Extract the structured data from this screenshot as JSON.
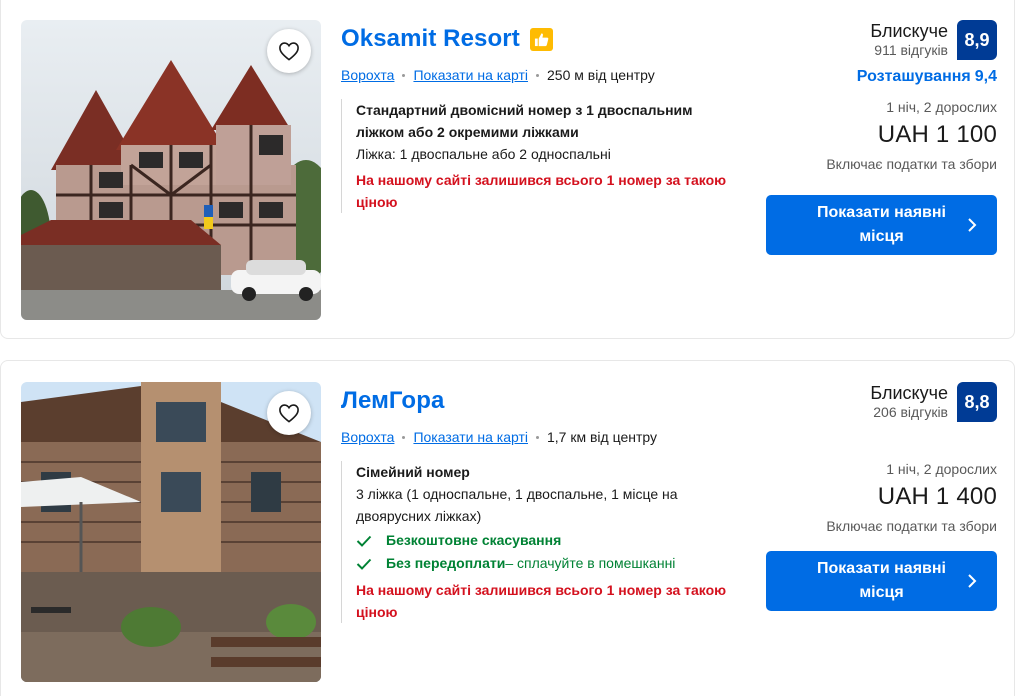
{
  "properties": [
    {
      "name": "Oksamit Resort",
      "has_genius_badge": true,
      "city": "Ворохта",
      "map_link": "Показати на карті",
      "distance": "250 м від центру",
      "room_name": "Стандартний двомісний номер з 1 двоспальним ліжком або 2 окремими ліжками",
      "beds": "Ліжка: 1 двоспальне або 2 односпальні",
      "warning": "На нашому сайті залишився всього 1 номер за такою ціною",
      "rating_word": "Блискуче",
      "review_count": "911 відгуків",
      "score": "8,9",
      "location_label": "Розташування",
      "location_score": "9,4",
      "occupancy": "1 ніч, 2 дорослих",
      "price": "UAH 1 100",
      "taxes": "Включає податки та збори",
      "cta": "Показати наявні місця"
    },
    {
      "name": "ЛемГора",
      "city": "Ворохта",
      "map_link": "Показати на карті",
      "distance": "1,7 км від центру",
      "room_name": "Сімейний номер",
      "beds": "3 ліжка (1 односпальне, 1 двоспальне, 1 місце на двоярусних ліжках)",
      "benefits": [
        {
          "label": "Безкоштовне скасування",
          "rest": ""
        },
        {
          "label": "Без передоплати",
          "rest": " – сплачуйте в помешканні"
        }
      ],
      "warning": "На нашому сайті залишився всього 1 номер за такою ціною",
      "rating_word": "Блискуче",
      "review_count": "206 відгуків",
      "score": "8,8",
      "occupancy": "1 ніч, 2 дорослих",
      "price": "UAH 1 400",
      "taxes": "Включає податки та збори",
      "cta": "Показати наявні місця"
    }
  ],
  "colors": {
    "link_blue": "#006ce4",
    "score_navy": "#003b95",
    "warning_red": "#d4111e",
    "benefit_green": "#008234",
    "genius_yellow": "#febb02"
  },
  "icons": [
    "heart-icon",
    "thumbs-up-icon",
    "check-icon",
    "chevron-right-icon"
  ]
}
